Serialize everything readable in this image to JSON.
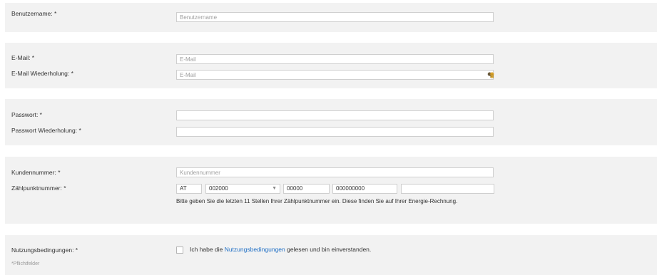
{
  "username": {
    "label": "Benutzername: *",
    "placeholder": "Benutzername"
  },
  "email": {
    "label": "E-Mail: *",
    "placeholder": "E-Mail"
  },
  "email_repeat": {
    "label": "E-Mail Wiederholung: *",
    "placeholder": "E-Mail",
    "icon": "password-manager-key-icon"
  },
  "password": {
    "label": "Passwort: *",
    "value": ""
  },
  "password_repeat": {
    "label": "Passwort Wiederholung: *",
    "value": ""
  },
  "customer_number": {
    "label": "Kundennummer: *",
    "placeholder": "Kundennummer"
  },
  "meter_point": {
    "label": "Zählpunktnummer: *",
    "country": "AT",
    "network": "002000",
    "postal": "00000",
    "number": "000000000",
    "last": "",
    "hint": "Bitte geben Sie die letzten 11 Stellen Ihrer Zählpunktnummer ein. Diese finden Sie auf Ihrer Energie-Rechnung."
  },
  "terms": {
    "label": "Nutzungsbedingungen: *",
    "text_before": "Ich habe die ",
    "link": "Nutzungsbedingungen",
    "text_after": " gelesen und bin einverstanden.",
    "checked": false
  },
  "footer": {
    "required_note": "*Pflichtfelder"
  },
  "colors": {
    "section_bg": "#f2f2f2",
    "link": "#1f6fc5",
    "border": "#cfcfcf"
  }
}
